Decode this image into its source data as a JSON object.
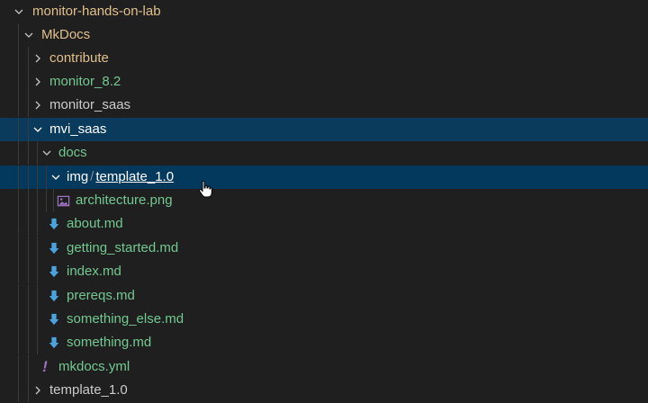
{
  "explorer": {
    "rows": [
      {
        "label": "monitor-hands-on-lab",
        "type": "folder",
        "expanded": true
      },
      {
        "label": "MkDocs",
        "type": "folder",
        "expanded": true
      },
      {
        "label": "contribute",
        "type": "folder",
        "expanded": false
      },
      {
        "label": "monitor_8.2",
        "type": "folder",
        "expanded": false
      },
      {
        "label": "monitor_saas",
        "type": "folder",
        "expanded": false
      },
      {
        "label": "mvi_saas",
        "type": "folder",
        "expanded": true
      },
      {
        "label": "docs",
        "type": "folder",
        "expanded": true
      },
      {
        "label_part1": "img",
        "label_sep": "/",
        "label_part2": "template_1.0",
        "type": "folder",
        "expanded": true
      },
      {
        "label": "architecture.png",
        "type": "image-file"
      },
      {
        "label": "about.md",
        "type": "markdown-file"
      },
      {
        "label": "getting_started.md",
        "type": "markdown-file"
      },
      {
        "label": "index.md",
        "type": "markdown-file"
      },
      {
        "label": "prereqs.md",
        "type": "markdown-file"
      },
      {
        "label": "something_else.md",
        "type": "markdown-file"
      },
      {
        "label": "something.md",
        "type": "markdown-file"
      },
      {
        "label": "mkdocs.yml",
        "type": "yaml-file",
        "icon_glyph": "!"
      },
      {
        "label": "template_1.0",
        "type": "folder",
        "expanded": false
      }
    ]
  },
  "colors": {
    "background": "#1f1f1f",
    "selection_parent": "#0b3b5c",
    "selection_focus": "#04395e",
    "modified": "#e2c08d",
    "untracked": "#73c991",
    "markdown_icon": "#4aa3df",
    "yaml_icon": "#a074c4"
  }
}
